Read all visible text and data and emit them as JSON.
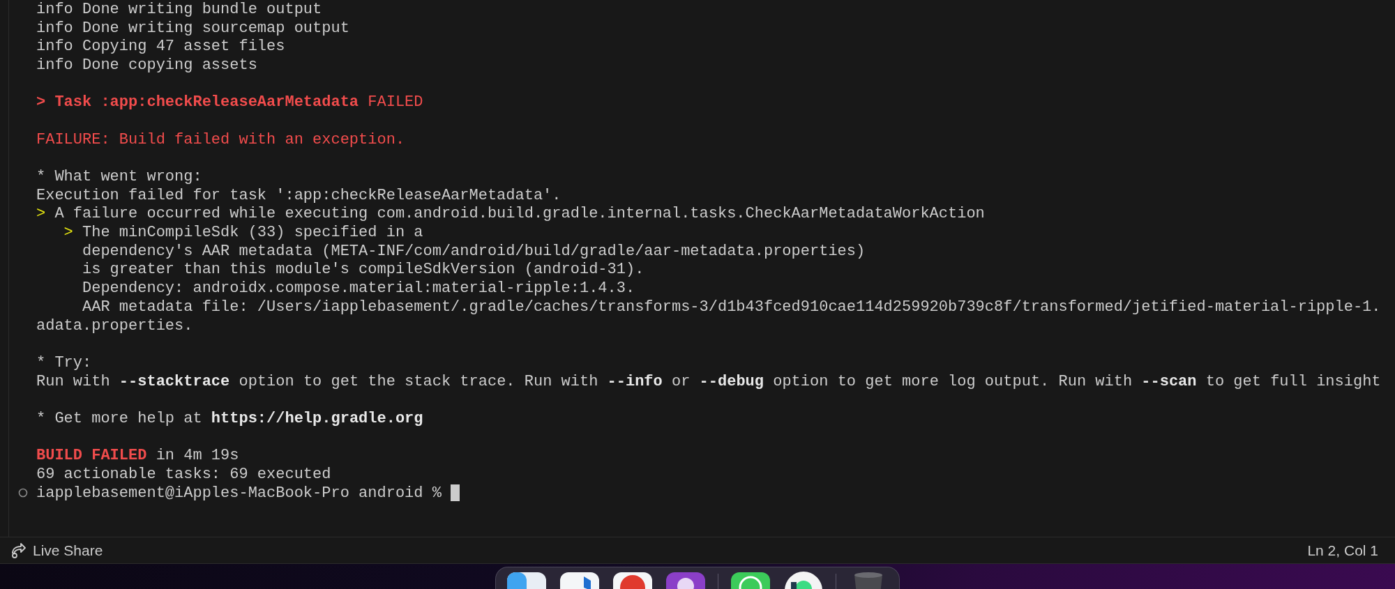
{
  "terminal": {
    "lines": [
      {
        "kind": "text",
        "segments": [
          {
            "text": "info Done writing bundle output",
            "kind": "plain"
          }
        ]
      },
      {
        "kind": "text",
        "segments": [
          {
            "text": "info Done writing sourcemap output",
            "kind": "plain"
          }
        ]
      },
      {
        "kind": "text",
        "segments": [
          {
            "text": "info Copying 47 asset files",
            "kind": "plain"
          }
        ]
      },
      {
        "kind": "text",
        "segments": [
          {
            "text": "info Done copying assets",
            "kind": "plain"
          }
        ]
      },
      {
        "kind": "blank"
      },
      {
        "kind": "text",
        "segments": [
          {
            "text": "> Task :app:checkReleaseAarMetadata",
            "kind": "error-bold"
          },
          {
            "text": " FAILED",
            "kind": "error"
          }
        ]
      },
      {
        "kind": "blank"
      },
      {
        "kind": "text",
        "segments": [
          {
            "text": "FAILURE: Build failed with an exception.",
            "kind": "error"
          }
        ]
      },
      {
        "kind": "blank"
      },
      {
        "kind": "text",
        "segments": [
          {
            "text": "* What went wrong:",
            "kind": "plain"
          }
        ]
      },
      {
        "kind": "text",
        "segments": [
          {
            "text": "Execution failed for task ':app:checkReleaseAarMetadata'.",
            "kind": "plain"
          }
        ]
      },
      {
        "kind": "text",
        "segments": [
          {
            "text": ">",
            "kind": "arrow"
          },
          {
            "text": " A failure occurred while executing com.android.build.gradle.internal.tasks.CheckAarMetadataWorkAction",
            "kind": "plain"
          }
        ]
      },
      {
        "kind": "text",
        "segments": [
          {
            "text": "   >",
            "kind": "arrow"
          },
          {
            "text": " The minCompileSdk (33) specified in a",
            "kind": "plain"
          }
        ]
      },
      {
        "kind": "text",
        "segments": [
          {
            "text": "     dependency's AAR metadata (META-INF/com/android/build/gradle/aar-metadata.properties)",
            "kind": "plain"
          }
        ]
      },
      {
        "kind": "text",
        "segments": [
          {
            "text": "     is greater than this module's compileSdkVersion (android-31).",
            "kind": "plain"
          }
        ]
      },
      {
        "kind": "text",
        "segments": [
          {
            "text": "     Dependency: androidx.compose.material:material-ripple:1.4.3.",
            "kind": "plain"
          }
        ]
      },
      {
        "kind": "text",
        "segments": [
          {
            "text": "     AAR metadata file: /Users/iapplebasement/.gradle/caches/transforms-3/d1b43fced910cae114d259920b739c8f/transformed/jetified-material-ripple-1.",
            "kind": "plain"
          }
        ]
      },
      {
        "kind": "text",
        "segments": [
          {
            "text": "adata.properties.",
            "kind": "plain"
          }
        ]
      },
      {
        "kind": "blank"
      },
      {
        "kind": "text",
        "segments": [
          {
            "text": "* Try:",
            "kind": "plain"
          }
        ]
      },
      {
        "kind": "text",
        "segments": [
          {
            "text": "Run with ",
            "kind": "plain"
          },
          {
            "text": "--stacktrace",
            "kind": "bold"
          },
          {
            "text": " option to get the stack trace. Run with ",
            "kind": "plain"
          },
          {
            "text": "--info",
            "kind": "bold"
          },
          {
            "text": " or ",
            "kind": "plain"
          },
          {
            "text": "--debug",
            "kind": "bold"
          },
          {
            "text": " option to get more log output. Run with ",
            "kind": "plain"
          },
          {
            "text": "--scan",
            "kind": "bold"
          },
          {
            "text": " to get full insight",
            "kind": "plain"
          }
        ]
      },
      {
        "kind": "blank"
      },
      {
        "kind": "text",
        "segments": [
          {
            "text": "* Get more help at ",
            "kind": "plain"
          },
          {
            "text": "https://help.gradle.org",
            "kind": "bold"
          }
        ]
      },
      {
        "kind": "blank"
      },
      {
        "kind": "text",
        "segments": [
          {
            "text": "BUILD FAILED",
            "kind": "error-bold"
          },
          {
            "text": " in 4m 19s",
            "kind": "plain"
          }
        ]
      },
      {
        "kind": "text",
        "segments": [
          {
            "text": "69 actionable tasks: 69 executed",
            "kind": "plain"
          }
        ]
      },
      {
        "kind": "prompt",
        "segments": [
          {
            "text": "iapplebasement@iApples-MacBook-Pro android %",
            "kind": "plain"
          }
        ]
      }
    ]
  },
  "status_bar": {
    "left": "Live Share",
    "right": "Ln 2, Col 1"
  }
}
